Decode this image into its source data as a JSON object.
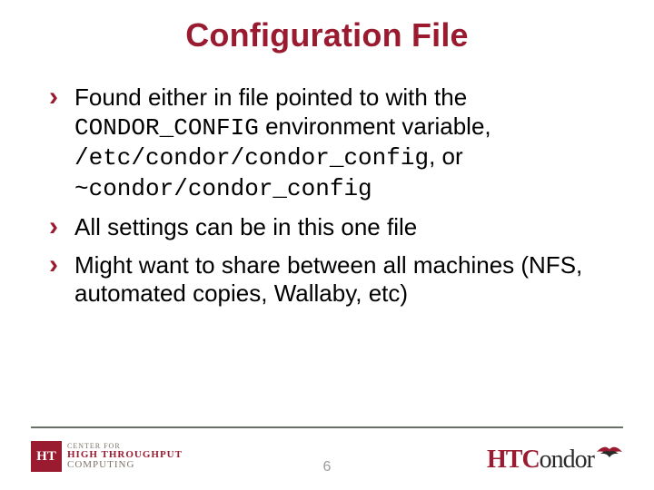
{
  "title": "Configuration File",
  "bullets": [
    {
      "pre": "Found either in file pointed to with the ",
      "code1": "CONDOR_CONFIG",
      "mid1": " environment variable, ",
      "code2": "/etc/condor/condor_config",
      "mid2": ", or ",
      "code3": "~condor/condor_config",
      "post": ""
    },
    {
      "text": "All settings can be in this one file"
    },
    {
      "text": "Might want to share between all machines (NFS, automated copies, Wallaby, etc)"
    }
  ],
  "page_number": "6",
  "logo_left": {
    "box": "HT",
    "line1": "CENTER FOR",
    "line2": "HIGH THROUGHPUT",
    "line3": "COMPUTING"
  },
  "logo_right": {
    "part1": "HTC",
    "part2": "ondor"
  }
}
